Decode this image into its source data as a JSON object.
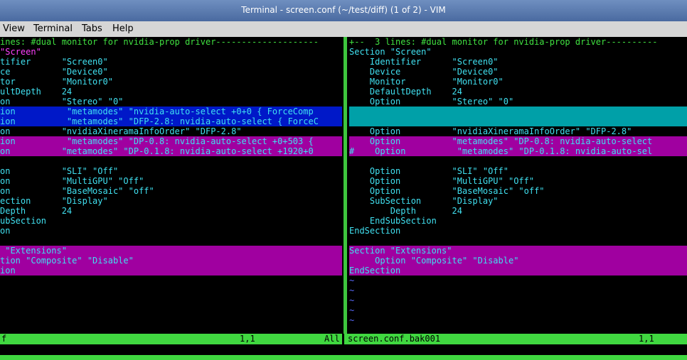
{
  "window": {
    "title": "Terminal - screen.conf (~/test/diff) (1 of 2) - VIM"
  },
  "menu": [
    "View",
    "Terminal",
    "Tabs",
    "Help"
  ],
  "colors": {
    "keyword": "#40e0f0",
    "identifier": "#ff40ff",
    "fold": "#40e040",
    "changed_bg": "#0018c8",
    "diff_bg": "#a000a0",
    "added_bg": "#00a0a8",
    "status_bg": "#40d840"
  },
  "left_pane": {
    "lines": [
      {
        "t": "ines: #dual monitor for nvidia-prop driver--------------------",
        "c": "c-green"
      },
      {
        "t": "\"Screen\"",
        "c": "c-magenta"
      },
      {
        "t": "tifier      \"Screen0\"",
        "c": "c-cyan"
      },
      {
        "t": "ce          \"Device0\"",
        "c": "c-cyan"
      },
      {
        "t": "tor         \"Monitor0\"",
        "c": "c-cyan"
      },
      {
        "t": "ultDepth    24",
        "c": "c-cyan"
      },
      {
        "t": "on          \"Stereo\" \"0\"",
        "c": "c-cyan"
      },
      {
        "t": "ion          \"metamodes\" \"nvidia-auto-select +0+0 { ForceComp",
        "c": "c-cyan",
        "bg": "hl-blue"
      },
      {
        "t": "ion          \"metamodes\" \"DFP-2.8: nvidia-auto-select { ForceC",
        "c": "c-cyan",
        "bg": "hl-blue"
      },
      {
        "t": "on          \"nvidiaXineramaInfoOrder\" \"DFP-2.8\"",
        "c": "c-cyan"
      },
      {
        "t": "ion          \"metamodes\" \"DP-0.8: nvidia-auto-select +0+503 {",
        "c": "c-cyan",
        "bg": "hl-magenta"
      },
      {
        "t": "on          \"metamodes\" \"DP-0.1.8: nvidia-auto-select +1920+0",
        "c": "c-cyan",
        "bg": "hl-magenta"
      },
      {
        "t": "",
        "c": "c-cyan"
      },
      {
        "t": "on          \"SLI\" \"Off\"",
        "c": "c-cyan"
      },
      {
        "t": "on          \"MultiGPU\" \"Off\"",
        "c": "c-cyan"
      },
      {
        "t": "on          \"BaseMosaic\" \"off\"",
        "c": "c-cyan"
      },
      {
        "t": "ection      \"Display\"",
        "c": "c-cyan"
      },
      {
        "t": "Depth       24",
        "c": "c-cyan"
      },
      {
        "t": "ubSection",
        "c": "c-cyan"
      },
      {
        "t": "on",
        "c": "c-cyan"
      },
      {
        "t": "",
        "c": "c-cyan"
      },
      {
        "t": " \"Extensions\"",
        "c": "c-cyan",
        "bg": "hl-magenta"
      },
      {
        "t": "tion \"Composite\" \"Disable\"",
        "c": "c-cyan",
        "bg": "hl-magenta"
      },
      {
        "t": "ion",
        "c": "c-cyan",
        "bg": "hl-magenta"
      }
    ],
    "status": {
      "name": "f",
      "pos": "1,1",
      "scroll": "All"
    }
  },
  "right_pane": {
    "lines": [
      {
        "t": "+--  3 lines: #dual monitor for nvidia-prop driver----------",
        "c": "c-green"
      },
      {
        "t": "Section \"Screen\"",
        "c": "c-cyan"
      },
      {
        "t": "    Identifier      \"Screen0\"",
        "c": "c-cyan"
      },
      {
        "t": "    Device          \"Device0\"",
        "c": "c-cyan"
      },
      {
        "t": "    Monitor         \"Monitor0\"",
        "c": "c-cyan"
      },
      {
        "t": "    DefaultDepth    24",
        "c": "c-cyan"
      },
      {
        "t": "    Option          \"Stereo\" \"0\"",
        "c": "c-cyan"
      },
      {
        "t": "",
        "c": "c-cyan",
        "bg": "hl-teal"
      },
      {
        "t": "",
        "c": "c-cyan",
        "bg": "hl-teal"
      },
      {
        "t": "    Option          \"nvidiaXineramaInfoOrder\" \"DFP-2.8\"",
        "c": "c-cyan"
      },
      {
        "t": "    Option          \"metamodes\" \"DP-0.8: nvidia-auto-select",
        "c": "c-cyan",
        "bg": "hl-magenta"
      },
      {
        "t": "#    Option          \"metamodes\" \"DP-0.1.8: nvidia-auto-sel",
        "c": "c-cyan",
        "bg": "hl-magenta"
      },
      {
        "t": "",
        "c": "c-cyan"
      },
      {
        "t": "    Option          \"SLI\" \"Off\"",
        "c": "c-cyan"
      },
      {
        "t": "    Option          \"MultiGPU\" \"Off\"",
        "c": "c-cyan"
      },
      {
        "t": "    Option          \"BaseMosaic\" \"off\"",
        "c": "c-cyan"
      },
      {
        "t": "    SubSection      \"Display\"",
        "c": "c-cyan"
      },
      {
        "t": "        Depth       24",
        "c": "c-cyan"
      },
      {
        "t": "    EndSubSection",
        "c": "c-cyan"
      },
      {
        "t": "EndSection",
        "c": "c-cyan"
      },
      {
        "t": "",
        "c": "c-cyan"
      },
      {
        "t": "Section \"Extensions\"",
        "c": "c-cyan",
        "bg": "hl-magenta"
      },
      {
        "t": "     Option \"Composite\" \"Disable\"",
        "c": "c-cyan",
        "bg": "hl-magenta"
      },
      {
        "t": "EndSection",
        "c": "c-cyan",
        "bg": "hl-magenta"
      },
      {
        "t": "~",
        "c": "c-blue"
      },
      {
        "t": "~",
        "c": "c-blue"
      },
      {
        "t": "~",
        "c": "c-blue"
      },
      {
        "t": "~",
        "c": "c-blue"
      },
      {
        "t": "~",
        "c": "c-blue"
      }
    ],
    "status": {
      "name": "screen.conf.bak001",
      "pos": "1,1"
    }
  }
}
